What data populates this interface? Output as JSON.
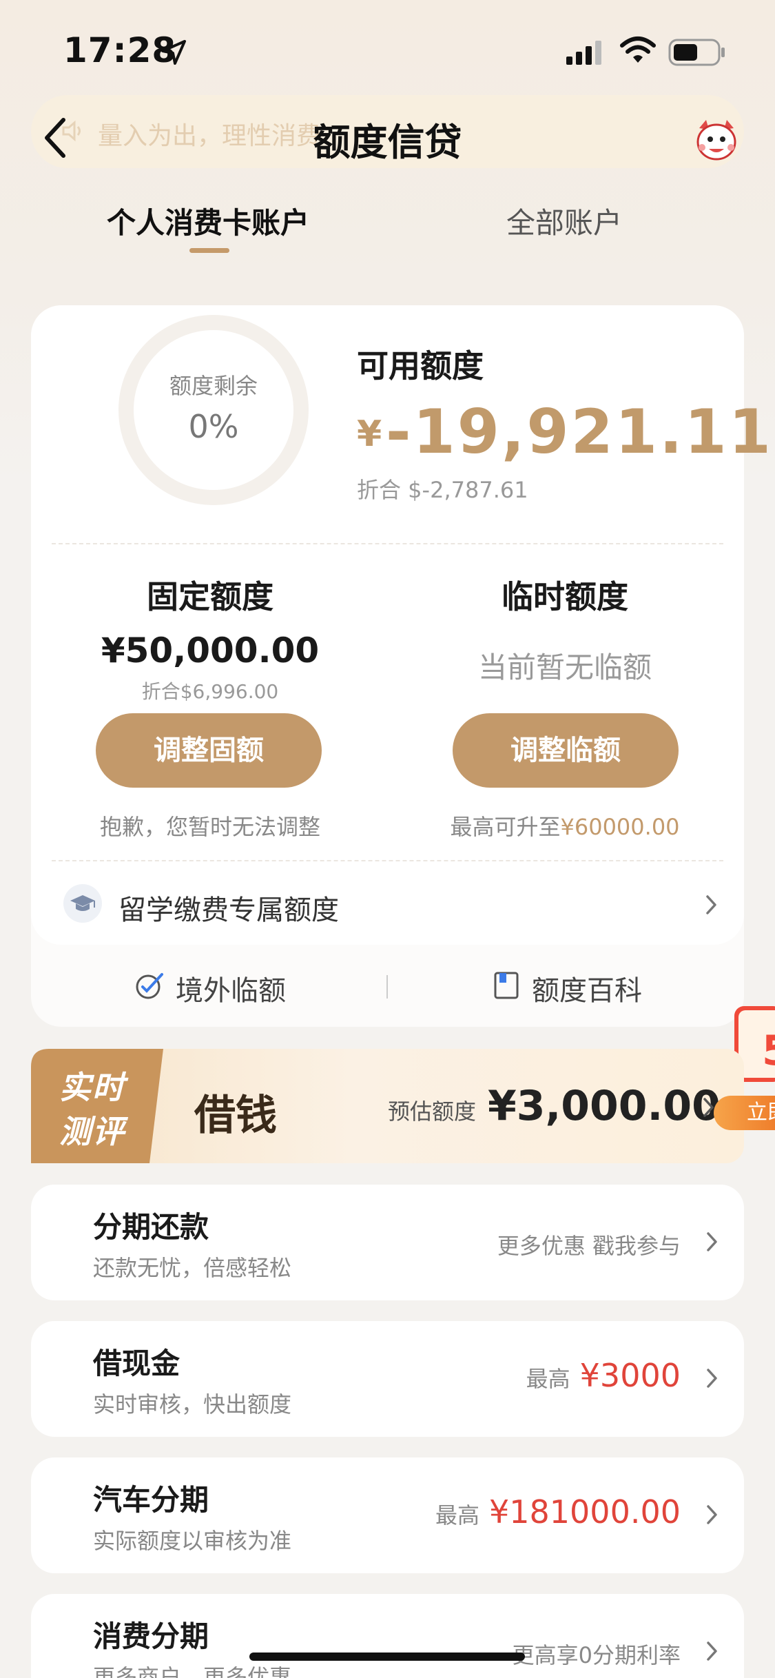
{
  "status_bar": {
    "time": "17:28"
  },
  "header": {
    "marquee": "量入为出，理性消费",
    "title": "额度信贷"
  },
  "tabs": [
    {
      "label": "个人消费卡账户",
      "active": true
    },
    {
      "label": "全部账户",
      "active": false
    }
  ],
  "credit": {
    "ring_label": "额度剩余",
    "ring_value": "0%",
    "available_label": "可用额度",
    "currency_symbol": "¥",
    "available_amount": "-19,921.11",
    "available_converted": "折合 $-2,787.61"
  },
  "fixed": {
    "title": "固定额度",
    "amount": "¥50,000.00",
    "converted": "折合$6,996.00",
    "button": "调整固额",
    "note": "抱歉，您暂时无法调整"
  },
  "temporary": {
    "title": "临时额度",
    "status": "当前暂无临额",
    "button": "调整临额",
    "note_prefix": "最高可升至",
    "note_amount": "¥60000.00"
  },
  "study_abroad": {
    "label": "留学缴费专属额度"
  },
  "links": [
    {
      "label": "境外临额",
      "icon": "overseas-icon"
    },
    {
      "label": "额度百科",
      "icon": "book-icon"
    }
  ],
  "promo_side": {
    "tag": "立即"
  },
  "banner": {
    "badge_line1": "实时",
    "badge_line2": "测评",
    "title": "借钱",
    "estimate_label": "预估额度",
    "estimate_value": "¥3,000.00"
  },
  "rows": [
    {
      "title": "分期还款",
      "subtitle": "还款无忧，倍感轻松",
      "right_text": "更多优惠 戳我参与",
      "right_amount": ""
    },
    {
      "title": "借现金",
      "subtitle": "实时审核，快出额度",
      "right_text": "最高",
      "right_amount": "¥3000"
    },
    {
      "title": "汽车分期",
      "subtitle": "实际额度以审核为准",
      "right_text": "最高",
      "right_amount": "¥181000.00"
    },
    {
      "title": "消费分期",
      "subtitle": "更多商户，更多优惠",
      "right_text": "更高享0分期利率",
      "right_amount": ""
    }
  ],
  "colors": {
    "accent": "#c3996a",
    "highlight_red": "#e0443a",
    "gold_text": "#c19a6b"
  }
}
